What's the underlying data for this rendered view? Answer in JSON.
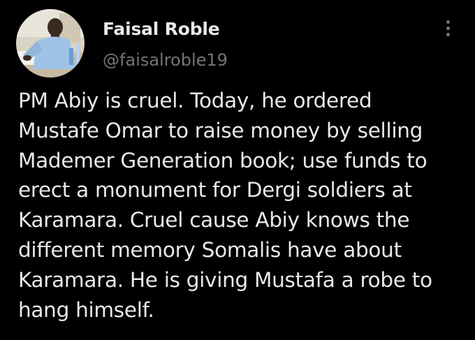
{
  "author": {
    "display_name": "Faisal Roble",
    "handle": "@faisalroble19",
    "avatar_icon": "profile-photo-man-writing-at-desk"
  },
  "menu": {
    "icon": "more-vertical-icon"
  },
  "tweet": {
    "lines": [
      "PM Abiy is cruel. Today, he ordered",
      "Mustafe Omar to raise money by selling",
      "Mademer Generation book; use funds to",
      "erect a monument for Dergi soldiers at",
      "Karamara.  Cruel cause Abiy knows the",
      "different memory Somalis have about",
      "Karamara. He is giving Mustafa a robe to",
      "hang himself."
    ]
  },
  "colors": {
    "background": "#000000",
    "primary_text": "#e7e9ea",
    "secondary_text": "#71767b"
  }
}
